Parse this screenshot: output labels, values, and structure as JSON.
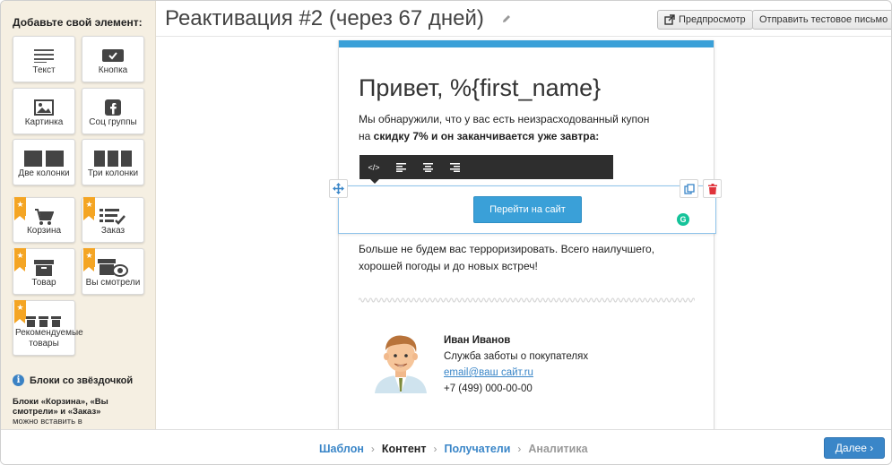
{
  "page_title": "Реактивация #2 (через 67 дней)",
  "header": {
    "preview_label": "Предпросмотр",
    "send_test_label": "Отправить тестовое письмо"
  },
  "sidebar": {
    "title": "Добавьте свой элемент:",
    "tiles": {
      "text": "Текст",
      "button": "Кнопка",
      "image": "Картинка",
      "social": "Соц группы",
      "two_cols": "Две колонки",
      "three_cols": "Три колонки",
      "cart": "Корзина",
      "order": "Заказ",
      "product": "Товар",
      "viewed": "Вы смотрели",
      "recommended": "Рекомендуемые товары"
    },
    "star_glyph": "★",
    "info_title": "Блоки со звёздочкой",
    "info_bold": "Блоки «Корзина», «Вы смотрели» и «Заказ»",
    "info_text": "можно вставить в автоматические рассылки по соответствующим"
  },
  "email": {
    "greeting": "Привет, %{first_name}",
    "para1_line1": "Мы обнаружили, что у вас есть неизрасходованный купон",
    "para1_prefix": "на ",
    "para1_bold": "скидку 7% и он заканчивается уже завтра:",
    "cta_label": "Перейти на сайт",
    "para2": "Больше не будем вас терроризировать. Всего наилучшего, хорошей погоды и до новых встреч!",
    "signature": {
      "name": "Иван Иванов",
      "role": "Служба заботы о покупателях",
      "email": "email@ваш сайт.ru",
      "phone": "+7 (499) 000-00-00"
    }
  },
  "footer": {
    "steps": [
      {
        "label": "Шаблон",
        "state": "done"
      },
      {
        "label": "Контент",
        "state": "current"
      },
      {
        "label": "Получатели",
        "state": "done"
      },
      {
        "label": "Аналитика",
        "state": "todo"
      }
    ],
    "next_label": "Далее"
  },
  "colors": {
    "accent": "#3aa0d8",
    "link": "#3a86c8",
    "ribbon": "#f4a524",
    "delete": "#e0343c",
    "sidebar_bg": "#f5efe2"
  }
}
